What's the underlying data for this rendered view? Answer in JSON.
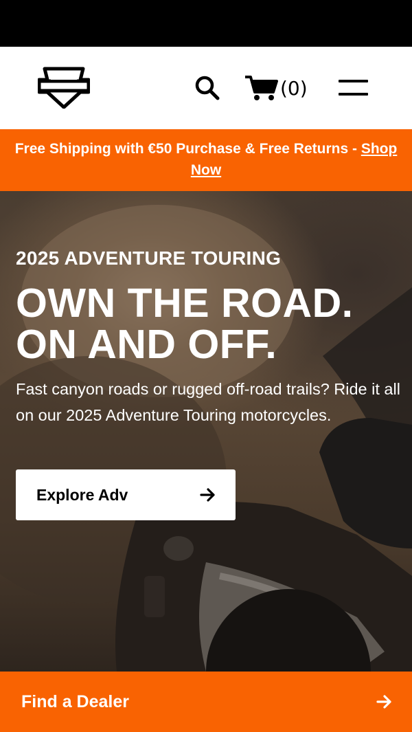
{
  "header": {
    "logo_icon": "shield-logo-icon",
    "search_icon": "search-icon",
    "cart_icon": "cart-icon",
    "cart_count": "(0)",
    "menu_icon": "hamburger-menu-icon"
  },
  "promo": {
    "text": "Free Shipping with €50 Purchase & Free Returns - ",
    "link": "Shop Now",
    "background_color": "#f96302"
  },
  "hero": {
    "eyebrow": "2025 ADVENTURE TOURING",
    "headline_line1": "OWN THE ROAD.",
    "headline_line2": "ON AND OFF.",
    "body": "Fast canyon roads or rugged off-road trails? Ride it all on our 2025 Adventure Touring motorcycles.",
    "cta_label": "Explore Adv",
    "cta_icon": "arrow-right-icon"
  },
  "footer_bar": {
    "label": "Find a Dealer",
    "icon": "arrow-right-icon",
    "background_color": "#f96302"
  }
}
